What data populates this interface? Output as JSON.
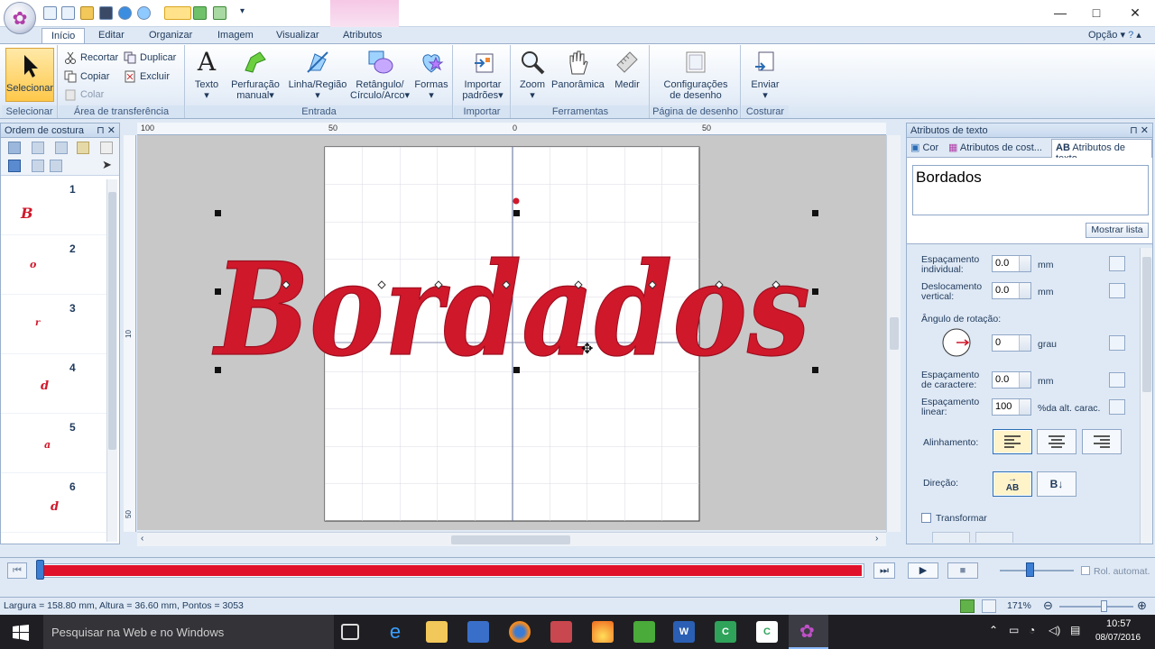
{
  "window": {
    "minimize": "—",
    "maximize": "□",
    "close": "✕"
  },
  "tabs": [
    "Início",
    "Editar",
    "Organizar",
    "Imagem",
    "Visualizar",
    "Atributos"
  ],
  "opcao": "Opção",
  "ribbon": {
    "selecionar": {
      "label": "Selecionar",
      "group": "Selecionar"
    },
    "clipboard": {
      "recortar": "Recortar",
      "copiar": "Copiar",
      "colar": "Colar",
      "duplicar": "Duplicar",
      "excluir": "Excluir",
      "group": "Área de transferência"
    },
    "entrada": {
      "texto": "Texto",
      "perfuracao1": "Perfuração",
      "perfuracao2": "manual",
      "linha": "Linha/Região",
      "retangulo1": "Retângulo/",
      "retangulo2": "Círculo/Arco",
      "formas": "Formas",
      "group": "Entrada"
    },
    "importar": {
      "label1": "Importar",
      "label2": "padrões",
      "group": "Importar"
    },
    "ferramentas": {
      "zoom": "Zoom",
      "panoramica": "Panorâmica",
      "medir": "Medir",
      "group": "Ferramentas"
    },
    "pagina": {
      "label1": "Configurações",
      "label2": "de desenho",
      "group": "Página de desenho"
    },
    "costurar": {
      "label": "Enviar",
      "group": "Costurar"
    }
  },
  "left_panel": {
    "title": "Ordem de costura",
    "items": [
      {
        "num": "1",
        "glyph": "B"
      },
      {
        "num": "2",
        "glyph": "o"
      },
      {
        "num": "3",
        "glyph": "r"
      },
      {
        "num": "4",
        "glyph": "d"
      },
      {
        "num": "5",
        "glyph": "a"
      },
      {
        "num": "6",
        "glyph": "d"
      }
    ]
  },
  "ruler": {
    "t100": "100",
    "t50a": "50",
    "t0": "0",
    "t50b": "50",
    "l10": "10",
    "l50": "50"
  },
  "canvas_text": "Bordados",
  "right_panel": {
    "title": "Atributos de texto",
    "tab_cor": "Cor",
    "tab_costura": "Atributos de cost...",
    "tab_texto": "Atributos de texto",
    "text_value": "Bordados",
    "mostrar_lista": "Mostrar lista",
    "esp_ind_1": "Espaçamento",
    "esp_ind_2": "individual:",
    "esp_ind_val": "0.0",
    "esp_ind_unit": "mm",
    "desl_1": "Deslocamento",
    "desl_2": "vertical:",
    "desl_val": "0.0",
    "desl_unit": "mm",
    "angulo": "Ângulo de rotação:",
    "angulo_val": "0",
    "angulo_unit": "grau",
    "esp_car_1": "Espaçamento",
    "esp_car_2": "de caractere:",
    "esp_car_val": "0.0",
    "esp_car_unit": "mm",
    "esp_lin_1": "Espaçamento",
    "esp_lin_2": "linear:",
    "esp_lin_val": "100",
    "esp_lin_unit": "%da alt. carac.",
    "alinhamento": "Alinhamento:",
    "direcao": "Direção:",
    "direcao_btn": "AB",
    "transformar": "Transformar"
  },
  "playbar": {
    "progress": 1.0,
    "rol": "Rol. automat."
  },
  "status": {
    "text": "Largura = 158.80 mm, Altura = 36.60 mm, Pontos = 3053",
    "zoom": "171%"
  },
  "taskbar": {
    "search": "Pesquisar na Web e no Windows",
    "time": "10:57",
    "date": "08/07/2016"
  },
  "colors": {
    "thread": "#d0182b",
    "accent": "#2a6db5"
  }
}
